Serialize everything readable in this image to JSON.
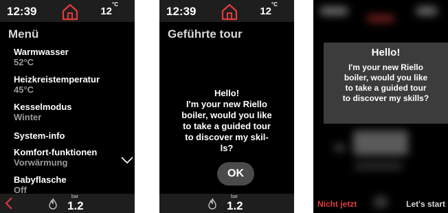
{
  "colors": {
    "accent": "#e23b3b",
    "background": "#000000",
    "bar": "#1e1e1e"
  },
  "screen1": {
    "status": {
      "time": "12:39",
      "temp": "12",
      "temp_unit": "°C",
      "home_icon": "home-icon"
    },
    "title": "Menü",
    "items": [
      {
        "label": "Warmwasser",
        "value": "52°C"
      },
      {
        "label": "Heizkreistemperatur",
        "value": "45°C"
      },
      {
        "label": "Kesselmodus",
        "value": "Winter"
      },
      {
        "label": "System-info",
        "value": ""
      },
      {
        "label": "Komfort-funktionen",
        "value": "Vorwärmung"
      },
      {
        "label": "Babyflasche",
        "value": "Off"
      }
    ],
    "bottom": {
      "bar_unit": "bar",
      "bar_value": "1.2",
      "icons": [
        "back-icon",
        "flame-icon"
      ]
    }
  },
  "screen2": {
    "status": {
      "time": "12:39",
      "temp": "12",
      "temp_unit": "°C"
    },
    "title": "Geführte tour",
    "message_title": "Hello!",
    "message_lines": [
      "I'm your new Riello",
      "boiler, would you like",
      "to take a guided tour",
      "to discover my skil-",
      "ls?"
    ],
    "ok_label": "OK",
    "bottom": {
      "bar_unit": "bar",
      "bar_value": "1.2"
    }
  },
  "screen3": {
    "dialog_title": "Hello!",
    "dialog_lines": [
      "I'm your new Riello",
      "boiler, would you like",
      "to take a guided tour",
      "to discover my skills?"
    ],
    "left_action": "Nicht jetzt",
    "right_action": "Let's start"
  }
}
